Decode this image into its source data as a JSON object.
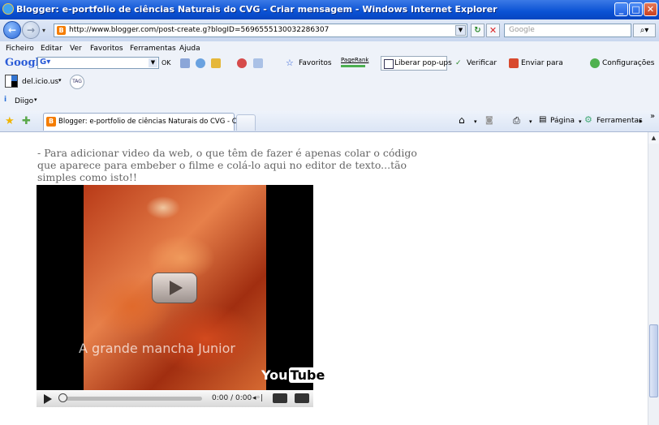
{
  "window": {
    "title": "Blogger: e-portfolio de ciências Naturais do CVG - Criar mensagem - Windows Internet Explorer",
    "min": "_",
    "max": "□",
    "close": "✕"
  },
  "address": {
    "url": "http://www.blogger.com/post-create.g?blogID=5696555130032286307",
    "search_placeholder": "Google"
  },
  "menu": [
    "Ficheiro",
    "Editar",
    "Ver",
    "Favoritos",
    "Ferramentas",
    "Ajuda"
  ],
  "google_toolbar": {
    "logo": "Google",
    "ok": "OK",
    "favoritos": "Favoritos",
    "pagerank": "PageRank",
    "liberar": "Liberar pop-ups",
    "verificar": "Verificar",
    "enviar": "Enviar para",
    "config": "Configurações"
  },
  "delicious": {
    "label": "del.icio.us",
    "tag": "TAG"
  },
  "diigo": {
    "label": "Diigo"
  },
  "tab": {
    "title": "Blogger: e-portfolio de ciências Naturais do CVG - Cria...",
    "pagina": "Página",
    "ferramentas": "Ferramentas"
  },
  "post": {
    "text": "- Para adicionar video da web, o que têm de fazer é apenas colar o código que aparece para embeber o filme e colá-lo aqui no editor de texto...tão simples como isto!!"
  },
  "video": {
    "overlay_text": "A grande mancha Junior",
    "yt_you": "You",
    "yt_tube": "Tube",
    "time": "0:00 / 0:00",
    "progress": 0
  }
}
